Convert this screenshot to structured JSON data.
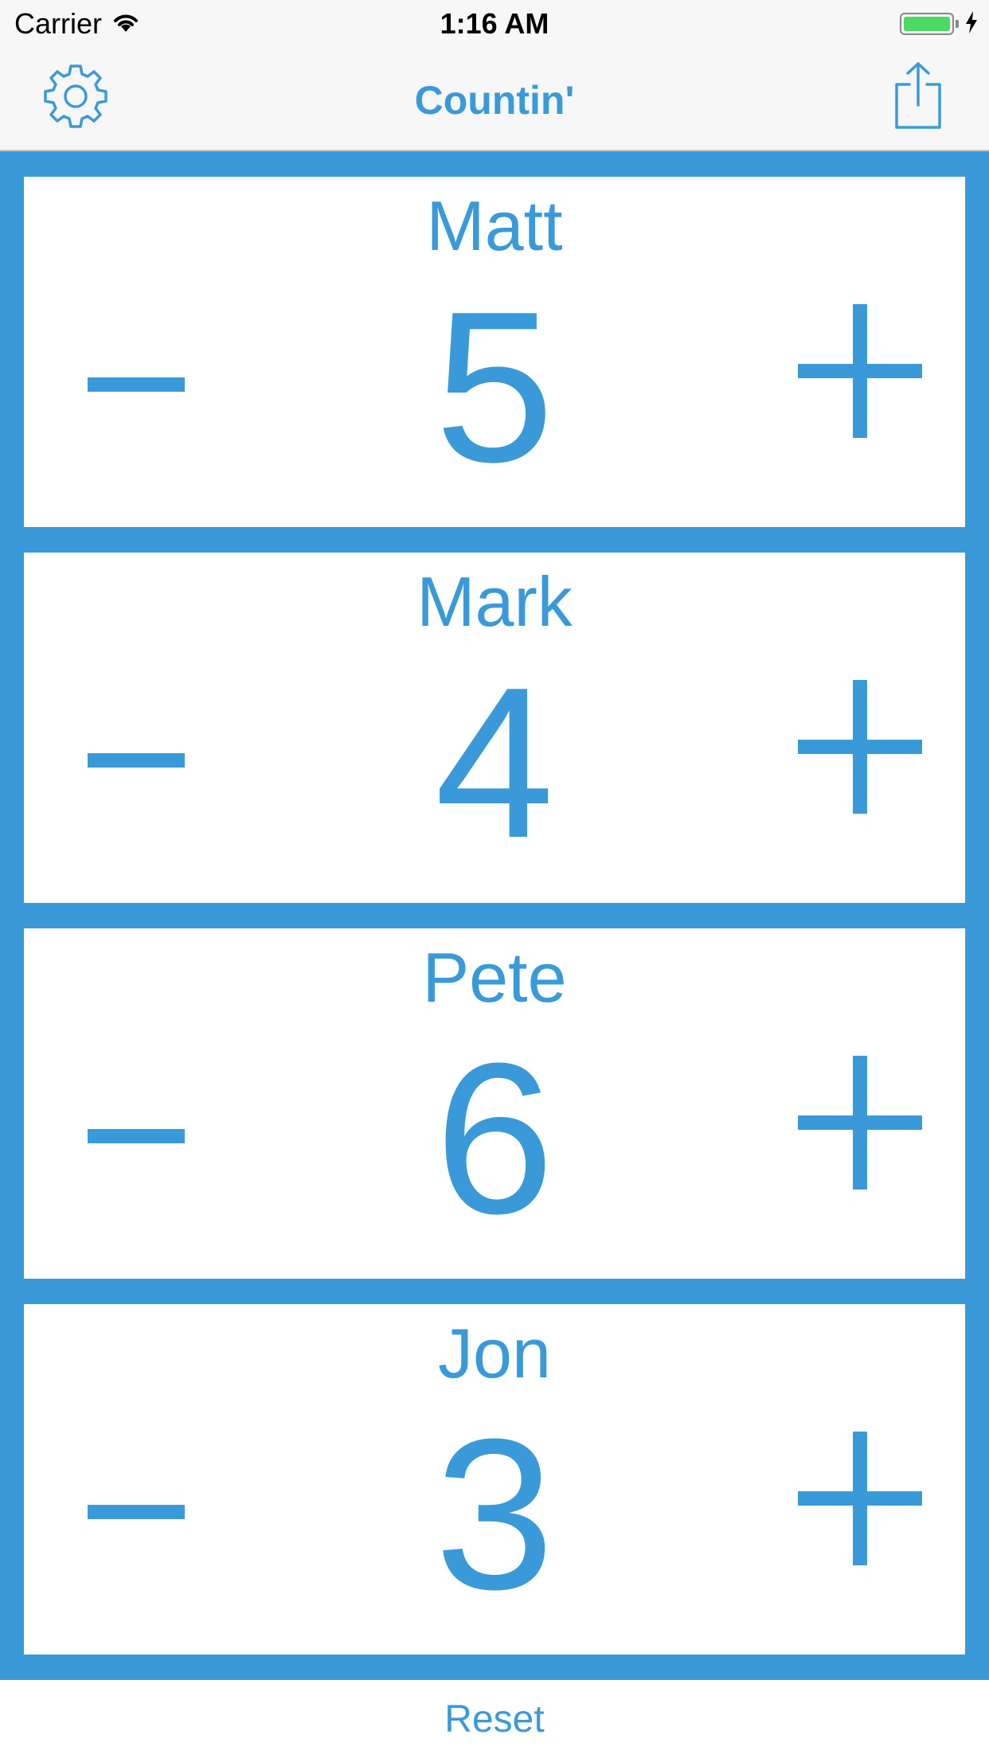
{
  "status_bar": {
    "carrier": "Carrier",
    "time": "1:16 AM",
    "icons": [
      "wifi-icon",
      "battery-icon",
      "charging-bolt-icon"
    ],
    "battery_color": "#4cd964"
  },
  "nav": {
    "title": "Countin'",
    "left_icon": "gear-icon",
    "right_icon": "share-icon"
  },
  "counters": [
    {
      "name": "Matt",
      "value": "5"
    },
    {
      "name": "Mark",
      "value": "4"
    },
    {
      "name": "Pete",
      "value": "6"
    },
    {
      "name": "Jon",
      "value": "3"
    }
  ],
  "footer": {
    "reset_label": "Reset"
  },
  "colors": {
    "accent": "#3a9ad9",
    "background": "#ffffff",
    "bar_background": "#f7f7f7"
  }
}
